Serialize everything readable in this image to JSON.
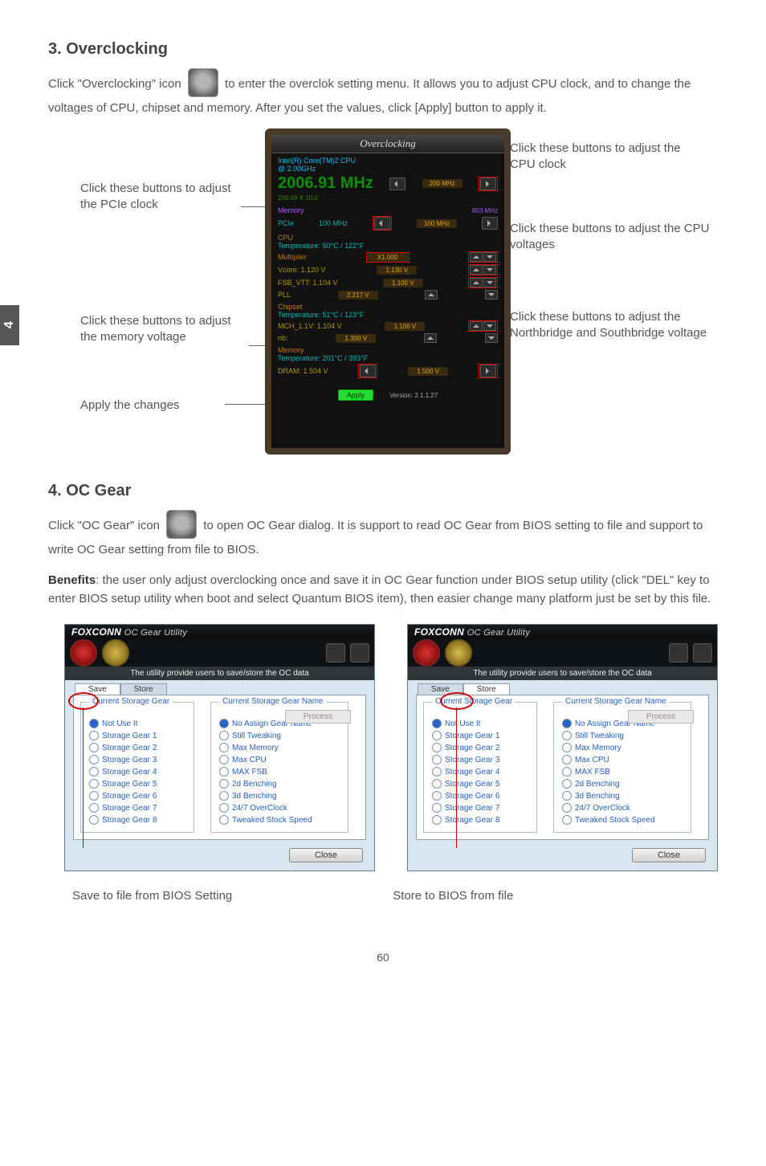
{
  "sideTab": "4",
  "sec1": {
    "title": "3. Overclocking",
    "p1a": "Click \"Overclocking\" icon",
    "p1b": "to enter the overclok setting menu. It allows you to adjust CPU clock, and to change the voltages of CPU, chipset and memory. After you set the values, click [Apply] button to apply it."
  },
  "callouts": {
    "pcie": "Click these buttons to adjust the PCIe clock",
    "mem": "Click these buttons to adjust the memory voltage",
    "apply": "Apply the changes",
    "cpu": "Click these buttons to adjust the CPU clock",
    "volt": "Click these buttons to adjust the CPU voltages",
    "nb": "Click these buttons to adjust the Northbridge and Southbridge voltage"
  },
  "oc": {
    "title": "Overclocking",
    "cpuName": "Intel(R) Core(TM)2 CPU",
    "cpuSub": "@ 2.00GHz",
    "mhz": "2006.91 MHz",
    "mhzSub": "200.69 X 10.0",
    "fsbLabel": "200 MHz",
    "memLabel": "803 MHz",
    "pciLabel": "PCIe",
    "pciVal": "100 MHz",
    "pcieBtn": "100 MHz",
    "cpuHdr": "CPU",
    "temp1": "Temperature: 50°C / 122°F",
    "mult": "Multiplier",
    "multV": "X1.000",
    "vcore": "Vcore: 1.120 V",
    "vcoreV": "1.130 V",
    "vtt": "FSB_VTT: 1.104 V",
    "vttV": "1.100 V",
    "pll": "PLL",
    "pllV": "2.217 V",
    "chip": "Chipset",
    "temp2": "Temperature: 51°C / 123°F",
    "mch": "MCH_1.1V: 1.104 V",
    "mchV": "1.100 V",
    "nbV": "1.300 V",
    "memHdr": "Memory",
    "temp3": "Temperature: 201°C / 393°F",
    "dram": "DRAM: 1.504 V",
    "dramV": "1.500 V",
    "apply": "Apply",
    "version": "Version: 2.1.1.27"
  },
  "sec2": {
    "title": "4. OC Gear",
    "p1a": "Click \"OC Gear\" icon",
    "p1b": "to open OC Gear dialog. It is support to read OC Gear from BIOS setting to file and support to write OC Gear setting from file to BIOS.",
    "benLabel": "Benefits",
    "benText": ": the user only adjust overclocking once and save it in OC Gear function under BIOS setup utility (click \"DEL\" key to enter BIOS setup utility when boot and select Quantum BIOS item), then easier change many platform just be set by this file."
  },
  "dialog": {
    "brand": "FOXCONN",
    "suffix": "OC Gear Utility",
    "legend": "The utility provide users to save/store the OC data",
    "tabSave": "Save",
    "tabStore": "Store",
    "grp1": "Current Storage Gear",
    "grp2": "Current Storage Gear Name",
    "notUse": "Not Use It",
    "gearItems": [
      "Storage Gear 1",
      "Storage Gear 2",
      "Storage Gear 3",
      "Storage Gear 4",
      "Storage Gear 5",
      "Storage Gear 6",
      "Storage Gear 7",
      "Storage Gear 8"
    ],
    "nameItems": [
      "No Assign Gear Name",
      "Still Tweaking",
      "Max Memory",
      "Max CPU",
      "MAX FSB",
      "2d Benching",
      "3d Benching",
      "24/7 OverClock",
      "Tweaked Stock Speed"
    ],
    "process": "Process",
    "close": "Close"
  },
  "captions": {
    "save": "Save to file from BIOS Setting",
    "store": "Store to BIOS from file"
  },
  "pageNumber": "60"
}
